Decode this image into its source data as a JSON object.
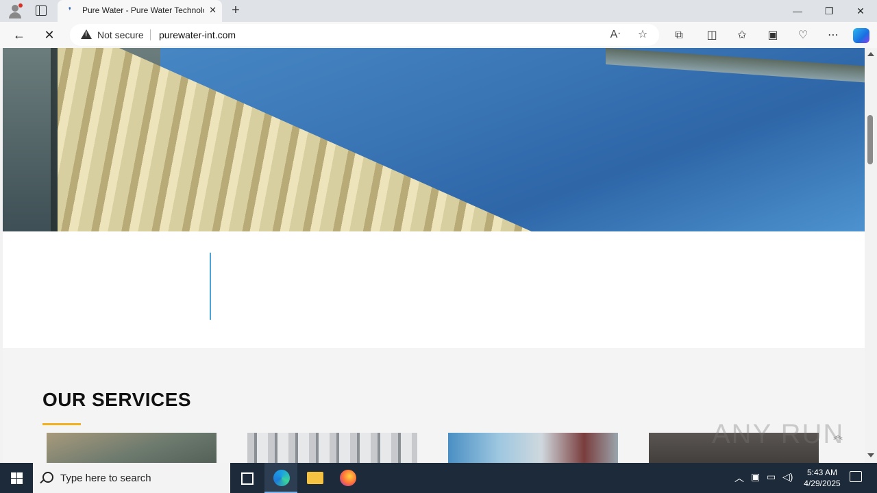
{
  "browser": {
    "tab_title": "Pure Water - Pure Water Technolo",
    "new_tab": "+",
    "security_label": "Not secure",
    "url": "purewater-int.com"
  },
  "page": {
    "services_heading": "OUR SERVICES",
    "accent_color": "#f2b01e",
    "divider_color": "#4aa4d6",
    "watermark": "ANY RUN"
  },
  "taskbar": {
    "search_placeholder": "Type here to search",
    "time": "5:43 AM",
    "date": "4/29/2025"
  },
  "icons": [
    "profile-icon",
    "tab-actions-icon",
    "favicon",
    "close-tab-icon",
    "back-icon",
    "stop-loading-icon",
    "warning-icon",
    "read-aloud-icon",
    "favorite-icon",
    "extensions-icon",
    "split-screen-icon",
    "favorites-icon",
    "collections-icon",
    "browser-essentials-icon",
    "more-icon",
    "copilot-icon",
    "windows-start-icon",
    "search-icon",
    "task-view-icon",
    "edge-icon",
    "file-explorer-icon",
    "firefox-icon",
    "chevron-up-icon",
    "network-icon",
    "volume-icon",
    "notifications-icon"
  ]
}
